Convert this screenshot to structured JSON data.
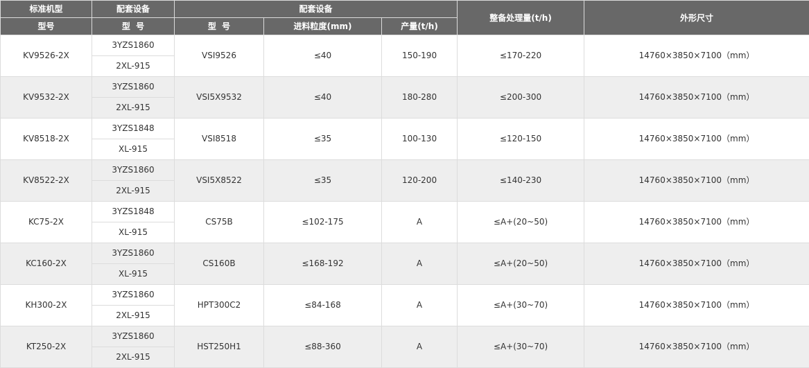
{
  "table": {
    "header": {
      "std_model_top": "标准机型",
      "std_model_bottom": "型号",
      "equip_group_1": "配套设备",
      "equip_model_1": "型  号",
      "equip_group_2": "配套设备",
      "equip_model_2": "型  号",
      "feed_size": "进料粒度(mm)",
      "output": "产量(t/h)",
      "capacity": "整备处理量(t/h)",
      "dimensions": "外形尺寸"
    },
    "rows": [
      {
        "model": "KV9526-2X",
        "equip_a": "3YZS1860",
        "equip_b": "2XL-915",
        "vsi": "VSI9526",
        "feed": "≤40",
        "output": "150-190",
        "capacity": "≤170-220",
        "dims": "14760×3850×7100（mm）"
      },
      {
        "model": "KV9532-2X",
        "equip_a": "3YZS1860",
        "equip_b": "2XL-915",
        "vsi": "VSI5X9532",
        "feed": "≤40",
        "output": "180-280",
        "capacity": "≤200-300",
        "dims": "14760×3850×7100（mm）"
      },
      {
        "model": "KV8518-2X",
        "equip_a": "3YZS1848",
        "equip_b": "XL-915",
        "vsi": "VSI8518",
        "feed": "≤35",
        "output": "100-130",
        "capacity": "≤120-150",
        "dims": "14760×3850×7100（mm）"
      },
      {
        "model": "KV8522-2X",
        "equip_a": "3YZS1860",
        "equip_b": "2XL-915",
        "vsi": "VSI5X8522",
        "feed": "≤35",
        "output": "120-200",
        "capacity": "≤140-230",
        "dims": "14760×3850×7100（mm）"
      },
      {
        "model": "KC75-2X",
        "equip_a": "3YZS1848",
        "equip_b": "XL-915",
        "vsi": "CS75B",
        "feed": "≤102-175",
        "output": "A",
        "capacity": "≤A+(20~50)",
        "dims": "14760×3850×7100（mm）"
      },
      {
        "model": "KC160-2X",
        "equip_a": "3YZS1860",
        "equip_b": "XL-915",
        "vsi": "CS160B",
        "feed": "≤168-192",
        "output": "A",
        "capacity": "≤A+(20~50)",
        "dims": "14760×3850×7100（mm）"
      },
      {
        "model": "KH300-2X",
        "equip_a": "3YZS1860",
        "equip_b": "2XL-915",
        "vsi": "HPT300C2",
        "feed": "≤84-168",
        "output": "A",
        "capacity": "≤A+(30~70)",
        "dims": "14760×3850×7100（mm）"
      },
      {
        "model": "KT250-2X",
        "equip_a": "3YZS1860",
        "equip_b": "2XL-915",
        "vsi": "HST250H1",
        "feed": "≤88-360",
        "output": "A",
        "capacity": "≤A+(30~70)",
        "dims": "14760×3850×7100（mm）"
      }
    ]
  }
}
